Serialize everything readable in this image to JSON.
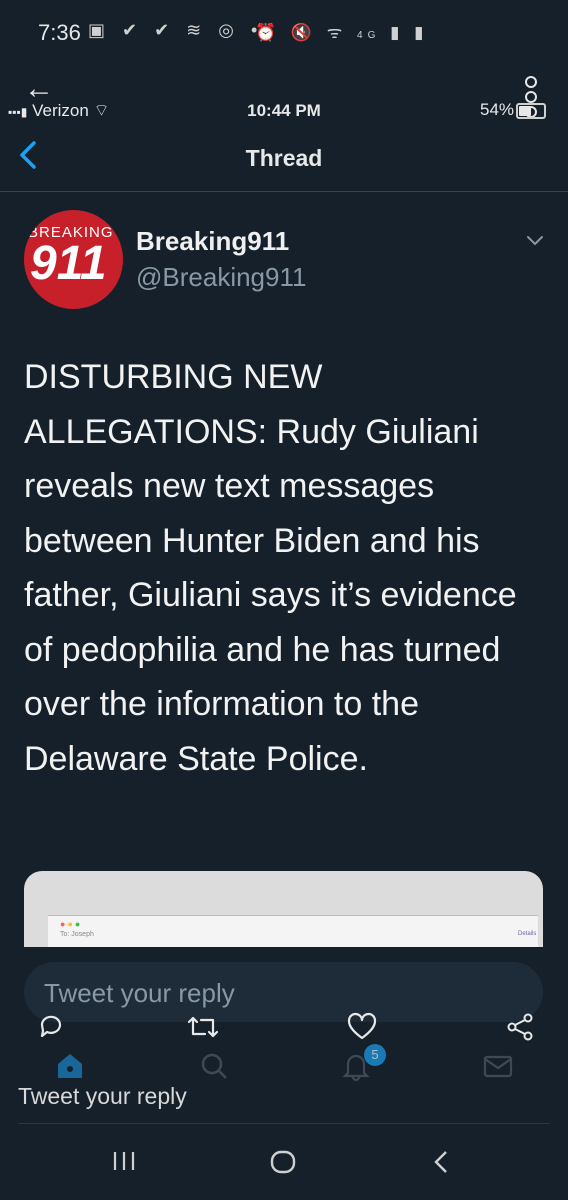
{
  "android_status": {
    "time": "7:36",
    "network": "4G"
  },
  "ios_status": {
    "carrier": "Verizon",
    "time": "10:44 PM",
    "battery": "54%"
  },
  "nav": {
    "title": "Thread"
  },
  "author": {
    "name": "Breaking911",
    "handle": "@Breaking911",
    "avatar_top": "BREAKING",
    "avatar_num": "911"
  },
  "tweet": {
    "text": "DISTURBING NEW ALLEGATIONS: Rudy Giuliani reveals new text messages between Hunter Biden and his father, Giuliani says it’s evidence of pedophilia and he has turned over the information to the Delaware State Police."
  },
  "media": {
    "to_label": "To: Joseph",
    "details": "Details"
  },
  "reply": {
    "placeholder": "Tweet your reply",
    "bottom_placeholder": "Tweet your reply"
  },
  "tabbar": {
    "notifications_badge": "5"
  },
  "colors": {
    "background": "#15202b",
    "accent": "#1da1f2",
    "secondary_text": "#8899a6"
  },
  "icons": [
    "back-arrow-icon",
    "more-dots-icon",
    "chevron-left-icon",
    "chevron-down-icon",
    "reply-icon",
    "retweet-icon",
    "like-icon",
    "share-icon",
    "home-icon",
    "search-icon",
    "notifications-icon",
    "messages-icon"
  ]
}
